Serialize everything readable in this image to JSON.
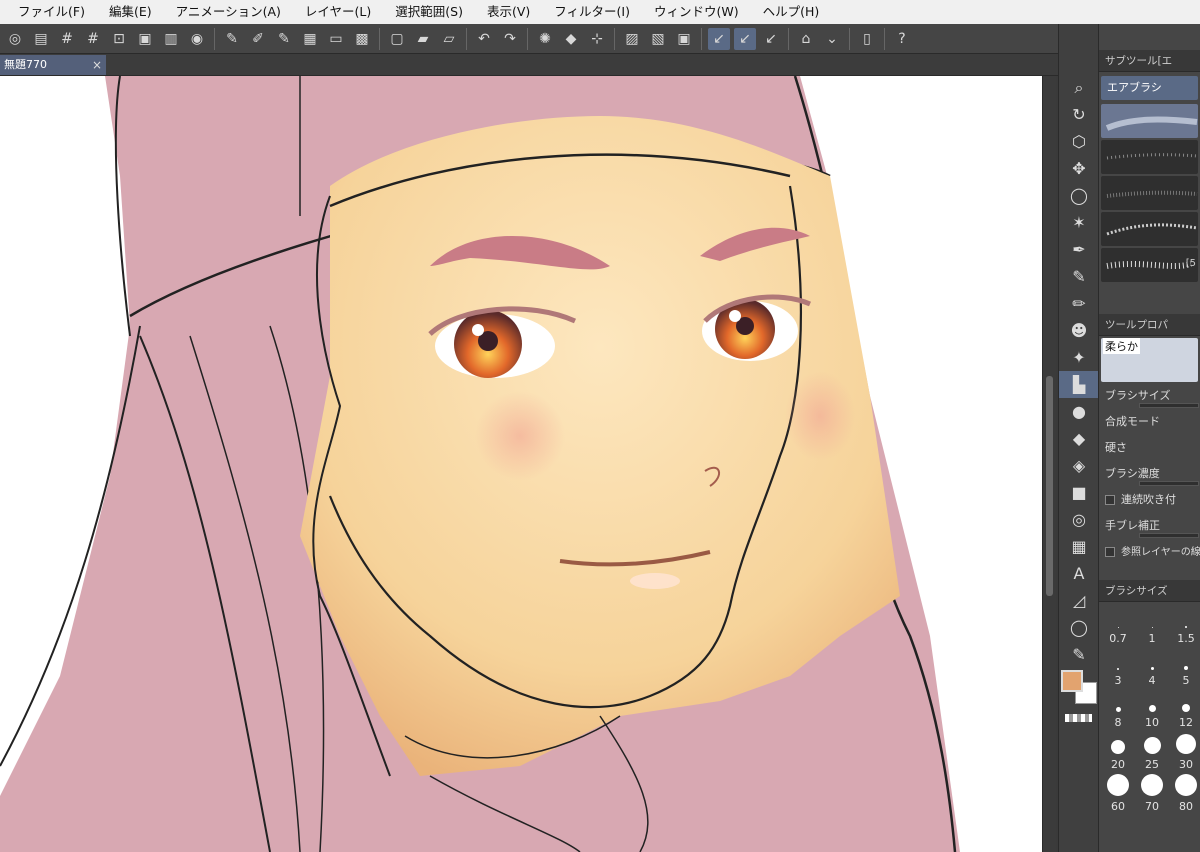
{
  "menu": [
    "ファイル(F)",
    "編集(E)",
    "アニメーション(A)",
    "レイヤー(L)",
    "選択範囲(S)",
    "表示(V)",
    "フィルター(I)",
    "ウィンドウ(W)",
    "ヘルプ(H)"
  ],
  "document_tab": {
    "title": "無題770",
    "close": "×"
  },
  "sub_tool_panel": {
    "header": "サブツール[エ",
    "tab_label": "エアブラシ",
    "trailing": "[5"
  },
  "tool_property": {
    "header": "ツールプロパ",
    "preset": "柔らか",
    "brush_size": "ブラシサイズ",
    "blend_mode": "合成モード",
    "hardness": "硬さ",
    "brush_density": "ブラシ濃度",
    "continuous_spray": "連続吹き付",
    "stabilization": "手ブレ補正",
    "reference_layer": "参照レイヤーの線"
  },
  "brush_size_panel": {
    "header": "ブラシサイズ",
    "sizes": [
      "0.7",
      "1",
      "1.5",
      "3",
      "4",
      "5",
      "8",
      "10",
      "12",
      "20",
      "25",
      "30",
      "60",
      "70",
      "80"
    ]
  },
  "colors": {
    "main": "#e2a36f",
    "sub": "#ffffff",
    "accent": "#5a6a86"
  }
}
